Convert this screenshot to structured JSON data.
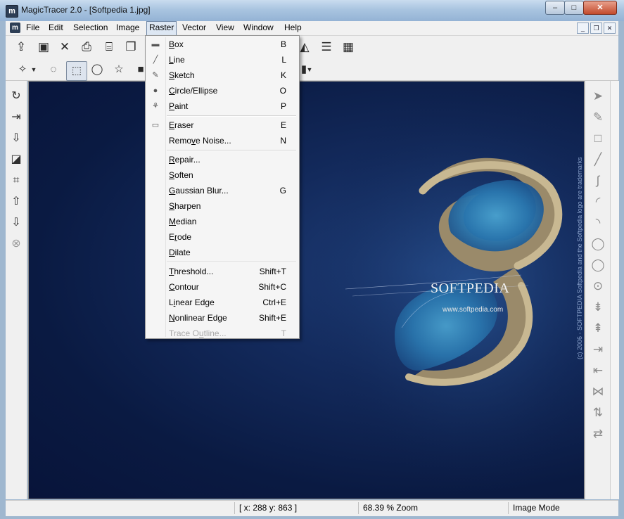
{
  "window": {
    "title": "MagicTracer 2.0 - [Softpedia 1.jpg]",
    "app_icon": "m",
    "controls": {
      "minimize": "–",
      "maximize": "□",
      "close": "✕"
    }
  },
  "menubar": {
    "doc_icon": "m",
    "items": [
      "File",
      "Edit",
      "Selection",
      "Image",
      "Raster",
      "Vector",
      "View",
      "Window",
      "Help"
    ],
    "active": "Raster",
    "mdi_controls": [
      "_",
      "❐",
      "✕"
    ]
  },
  "toolbar_main": {
    "icons": [
      "open-icon",
      "save-icon",
      "close-icon",
      "print-icon",
      "scan-icon",
      "copy-icon",
      "triangle-icon",
      "lines-icon",
      "grid-icon"
    ]
  },
  "toolbar_select": {
    "icons": [
      "magic-wand-icon",
      "lasso-icon",
      "rect-select-icon",
      "ellipse-select-icon",
      "star-select-icon",
      "fill-icon"
    ],
    "selected": "rect-select-icon"
  },
  "raster_menu": {
    "items": [
      {
        "label": "Box",
        "accel": "B",
        "shortcut": "B",
        "icon": "box-icon"
      },
      {
        "label": "Line",
        "accel": "L",
        "shortcut": "L",
        "icon": "line-icon"
      },
      {
        "label": "Sketch",
        "accel": "S",
        "shortcut": "K",
        "icon": "sketch-icon"
      },
      {
        "label": "Circle/Ellipse",
        "accel": "C",
        "shortcut": "O",
        "icon": "circle-icon"
      },
      {
        "label": "Paint",
        "accel": "P",
        "shortcut": "P",
        "icon": "paint-icon"
      },
      {
        "separator": true
      },
      {
        "label": "Eraser",
        "accel": "E",
        "shortcut": "E",
        "icon": "eraser-icon"
      },
      {
        "label": "Remove Noise...",
        "accel": "v",
        "shortcut": "N",
        "icon": ""
      },
      {
        "separator": true
      },
      {
        "label": "Repair...",
        "accel": "R",
        "shortcut": "",
        "icon": ""
      },
      {
        "label": "Soften",
        "accel": "S",
        "shortcut": "",
        "icon": ""
      },
      {
        "label": "Gaussian Blur...",
        "accel": "G",
        "shortcut": "G",
        "icon": ""
      },
      {
        "label": "Sharpen",
        "accel": "S",
        "shortcut": "",
        "icon": ""
      },
      {
        "label": "Median",
        "accel": "M",
        "shortcut": "",
        "icon": ""
      },
      {
        "label": "Erode",
        "accel": "r",
        "shortcut": "",
        "icon": ""
      },
      {
        "label": "Dilate",
        "accel": "D",
        "shortcut": "",
        "icon": ""
      },
      {
        "separator": true
      },
      {
        "label": "Threshold...",
        "accel": "T",
        "shortcut": "Shift+T",
        "icon": ""
      },
      {
        "label": "Contour",
        "accel": "C",
        "shortcut": "Shift+C",
        "icon": ""
      },
      {
        "label": "Linear Edge",
        "accel": "i",
        "shortcut": "Ctrl+E",
        "icon": ""
      },
      {
        "label": "Nonlinear Edge",
        "accel": "N",
        "shortcut": "Shift+E",
        "icon": ""
      },
      {
        "label": "Trace Outline...",
        "accel": "u",
        "shortcut": "T",
        "icon": "",
        "disabled": true
      }
    ]
  },
  "image": {
    "watermark": "SOFTPEDIA",
    "url": "www.softpedia.com",
    "side_text": "(c) 2006 - SOFTPEDIA Softpedia and the Softpedia logo are trademarks"
  },
  "status": {
    "coords": "[ x: 288 y: 863 ]",
    "zoom": "68.39 % Zoom",
    "mode": "Image Mode"
  },
  "colors": {
    "canvas_dark": "#08143a",
    "island": "#9a8a6a",
    "lagoon": "#2a78b0",
    "menu_bg": "#f5f5f5"
  }
}
